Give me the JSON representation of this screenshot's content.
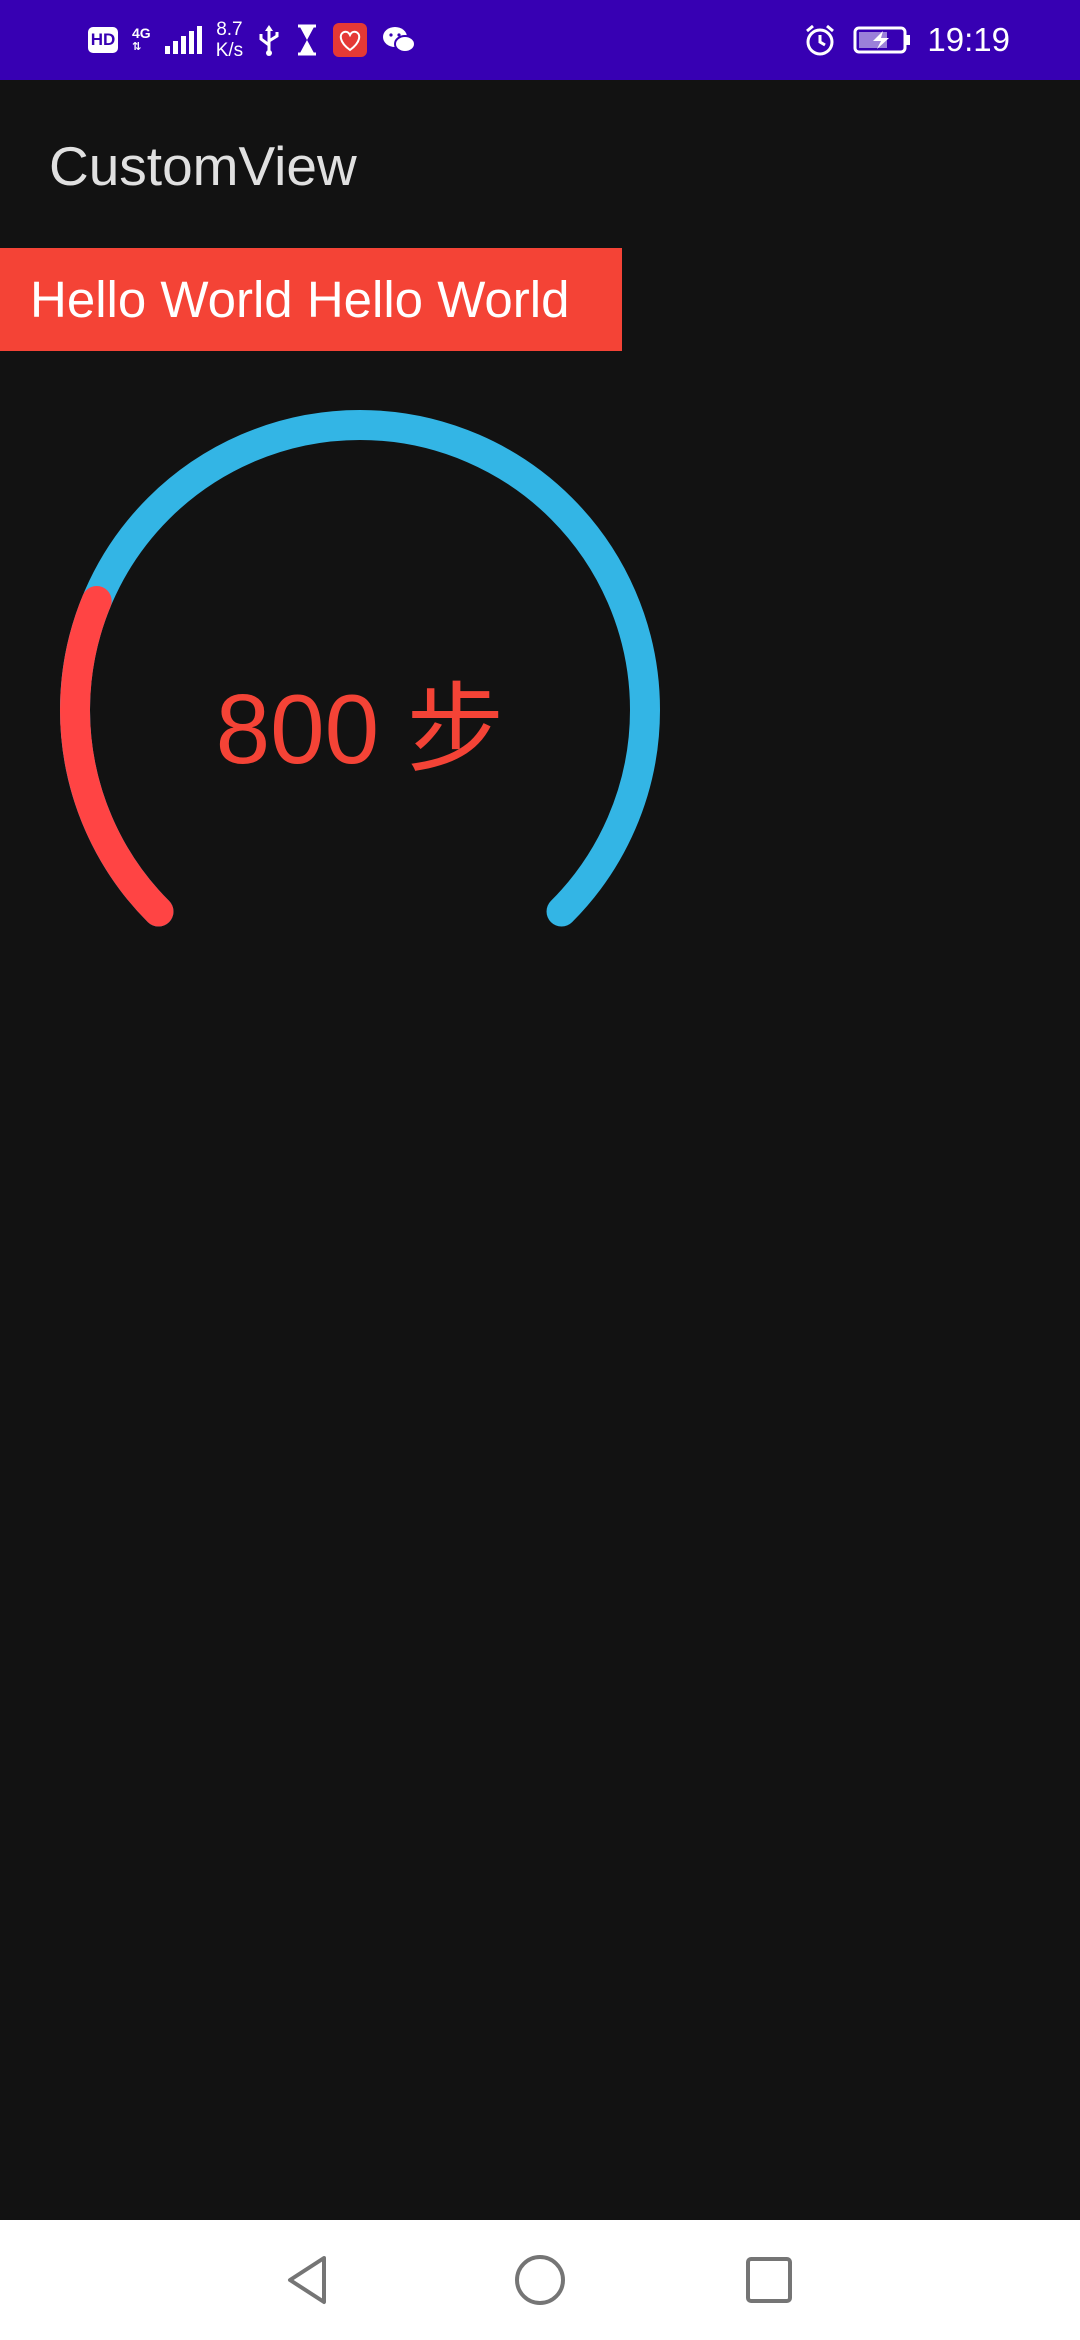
{
  "status_bar": {
    "hd": "HD",
    "net_type": "4G",
    "speed_value": "8.7",
    "speed_unit": "K/s",
    "time": "19:19",
    "icons": [
      "hd-badge-icon",
      "signal-icon",
      "usb-icon",
      "hourglass-icon",
      "app-badge-icon",
      "wechat-icon",
      "alarm-icon",
      "battery-charging-icon"
    ],
    "background": "#3700B3"
  },
  "toolbar": {
    "title": "CustomView"
  },
  "hello_view": {
    "text": "Hello World Hello World",
    "background": "#F44336"
  },
  "step_gauge": {
    "value_text": "800 步",
    "progress_color": "#FF4444",
    "track_color": "#33B5E5",
    "progress_fraction": 0.25
  },
  "nav_bar": {
    "icons": [
      "back-icon",
      "home-icon",
      "recents-icon"
    ]
  }
}
